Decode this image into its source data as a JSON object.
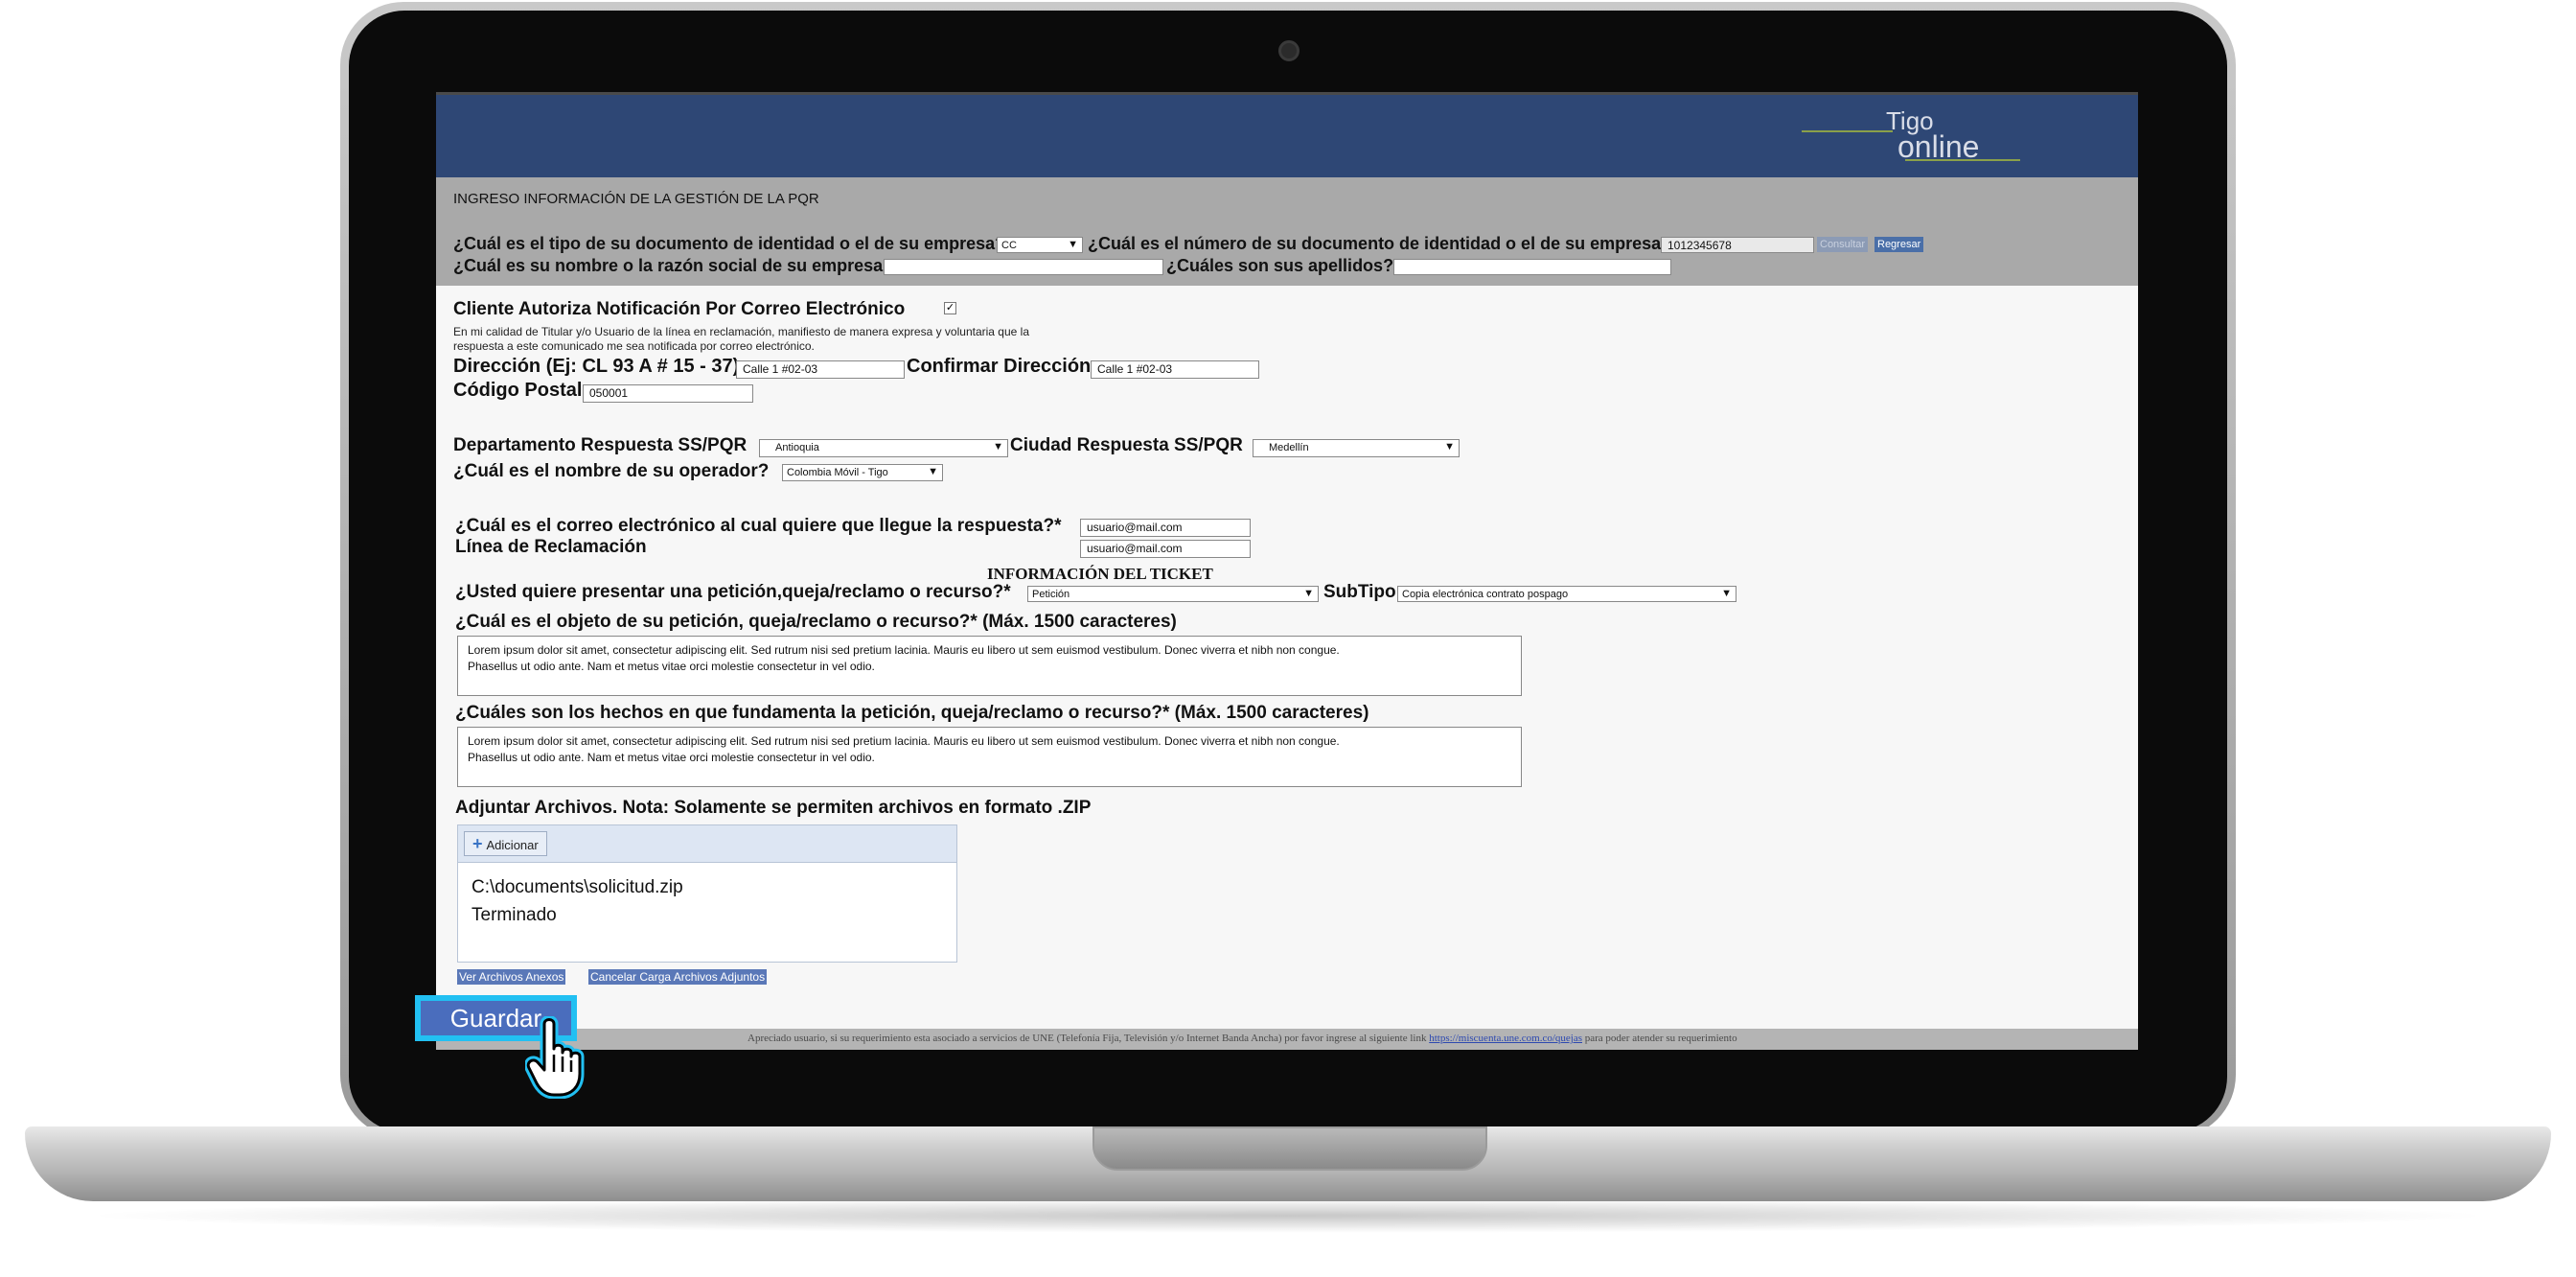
{
  "header": {
    "logo_top": "Tigo",
    "logo_bottom": "online"
  },
  "page_title": "INGRESO INFORMACIÓN DE LA GESTIÓN DE LA PQR",
  "doc_type": {
    "label": "¿Cuál es el tipo de su documento de identidad o el de su empresa?*",
    "value": "CC"
  },
  "doc_number": {
    "label": "¿Cuál es el número de su documento de identidad o el de su empresa?*",
    "value": "1012345678"
  },
  "consultar_label": "Consultar",
  "regresar_label": "Regresar",
  "name": {
    "label": "¿Cuál es su nombre o la razón social de su empresa?",
    "value": ""
  },
  "surnames": {
    "label": "¿Cuáles son sus apellidos?*",
    "value": ""
  },
  "email_notify": {
    "label": "Cliente Autoriza Notificación Por Correo Electrónico",
    "checked": true,
    "note_line1": "En mi calidad de Titular y/o Usuario de la línea en reclamación, manifiesto de manera expresa y voluntaria que la",
    "note_line2": "respuesta a este comunicado me sea notificada por correo electrónico."
  },
  "address": {
    "label": "Dirección (Ej: CL 93 A # 15 - 37)",
    "value": "Calle 1 #02-03"
  },
  "address_confirm": {
    "label": "Confirmar Dirección",
    "value": "Calle 1 #02-03"
  },
  "postal": {
    "label": "Código Postal",
    "value": "050001"
  },
  "department": {
    "label": "Departamento Respuesta SS/PQR",
    "value": "Antioquia"
  },
  "city": {
    "label": "Ciudad Respuesta SS/PQR",
    "value": "Medellín"
  },
  "operator": {
    "label": "¿Cuál es el nombre de su operador?",
    "value": "Colombia Móvil - Tigo"
  },
  "response_email": {
    "label": "¿Cuál es el correo electrónico al cual quiere que llegue la respuesta?*",
    "value": "usuario@mail.com"
  },
  "claim_line": {
    "label": "Línea de Reclamación",
    "value": "usuario@mail.com"
  },
  "ticket_header": "INFORMACIÓN DEL TICKET",
  "request_type": {
    "label": "¿Usted quiere presentar una petición,queja/reclamo o recurso?*",
    "value": "Petición"
  },
  "subtype": {
    "label": "SubTipo",
    "value": "Copia electrónica contrato pospago"
  },
  "object": {
    "label": "¿Cuál es el objeto de su petición, queja/reclamo o recurso?* (Máx. 1500 caracteres)",
    "line1": "Lorem ipsum dolor sit amet, consectetur adipiscing elit. Sed rutrum nisi sed pretium lacinia. Mauris eu libero ut sem euismod vestibulum. Donec viverra et nibh non congue.",
    "line2": "Phasellus ut odio ante. Nam et metus vitae orci molestie consectetur in vel odio."
  },
  "facts": {
    "label": "¿Cuáles son los hechos en que fundamenta la petición, queja/reclamo o recurso?* (Máx. 1500 caracteres)",
    "line1": "Lorem ipsum dolor sit amet, consectetur adipiscing elit. Sed rutrum nisi sed pretium lacinia. Mauris eu libero ut sem euismod vestibulum. Donec viverra et nibh non congue.",
    "line2": "Phasellus ut odio ante. Nam et metus vitae orci molestie consectetur in vel odio."
  },
  "attachments": {
    "label": "Adjuntar Archivos. Nota: Solamente se permiten archivos en formato .ZIP",
    "add_label": "Adicionar",
    "file_name": "C:\\documents\\solicitud.zip",
    "status": "Terminado"
  },
  "links": {
    "view_attachments": "Ver Archivos Anexos",
    "cancel_upload": "Cancelar Carga Archivos Adjuntos"
  },
  "save_label": "Guardar",
  "footer": {
    "text_before": "Apreciado usuario, si su requerimiento esta asociado a servicios de UNE (Telefonía Fija, Televisión y/o Internet Banda Ancha) por favor ingrese al siguiente link",
    "link": "https://miscuenta.une.com.co/quejas",
    "text_after": "para poder atender su requerimiento"
  },
  "colors": {
    "header_bg": "#2e4775",
    "band_gray": "#a9a9a9",
    "save_button": "#4a6dbd",
    "highlight_border": "#22c0f2"
  }
}
